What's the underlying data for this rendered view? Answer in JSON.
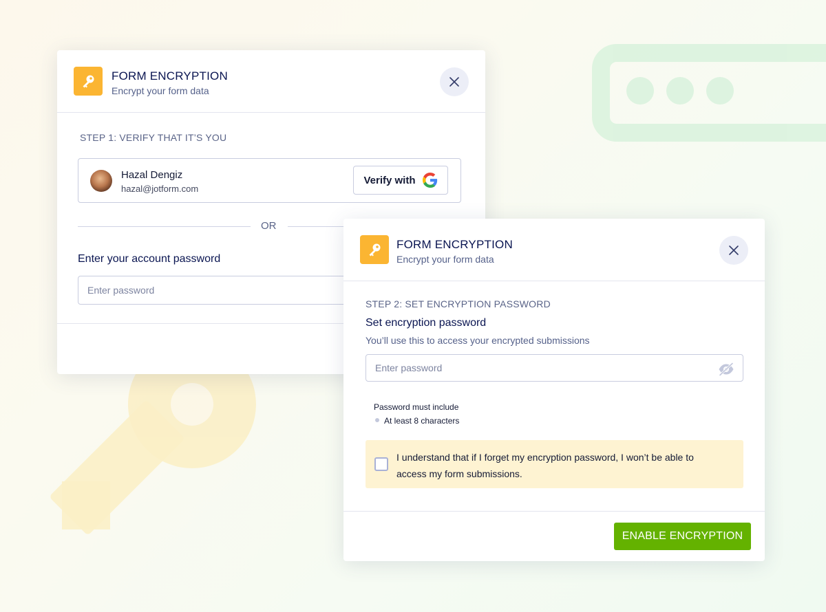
{
  "modal_step1": {
    "title": "FORM ENCRYPTION",
    "subtitle": "Encrypt your form data",
    "step_label": "STEP 1: VERIFY THAT IT’S YOU",
    "account": {
      "name": "Hazal Dengiz",
      "email": "hazal@jotform.com"
    },
    "verify_button_label": "Verify with",
    "or_label": "OR",
    "password_label": "Enter your account password",
    "password_placeholder": "Enter password"
  },
  "modal_step2": {
    "title": "FORM ENCRYPTION",
    "subtitle": "Encrypt your form data",
    "step_label": "STEP 2: SET ENCRYPTION PASSWORD",
    "field_label": "Set encryption password",
    "field_hint": "You’ll use this to access your encrypted submissions",
    "password_placeholder": "Enter password",
    "rules_title": "Password must include",
    "rules": [
      "At least 8 characters"
    ],
    "acknowledge_text": "I understand that if I forget my encryption password, I won’t be able to access my form submissions.",
    "submit_label": "ENABLE ENCRYPTION"
  },
  "icons": {
    "header": "key-icon",
    "close": "close-icon",
    "verify": "google-icon",
    "password_toggle": "eye-slash-icon"
  },
  "colors": {
    "key_badge": "#fbb532",
    "primary_button": "#64b200",
    "notice_background": "#fef3d2",
    "title_text": "#0a1551"
  }
}
